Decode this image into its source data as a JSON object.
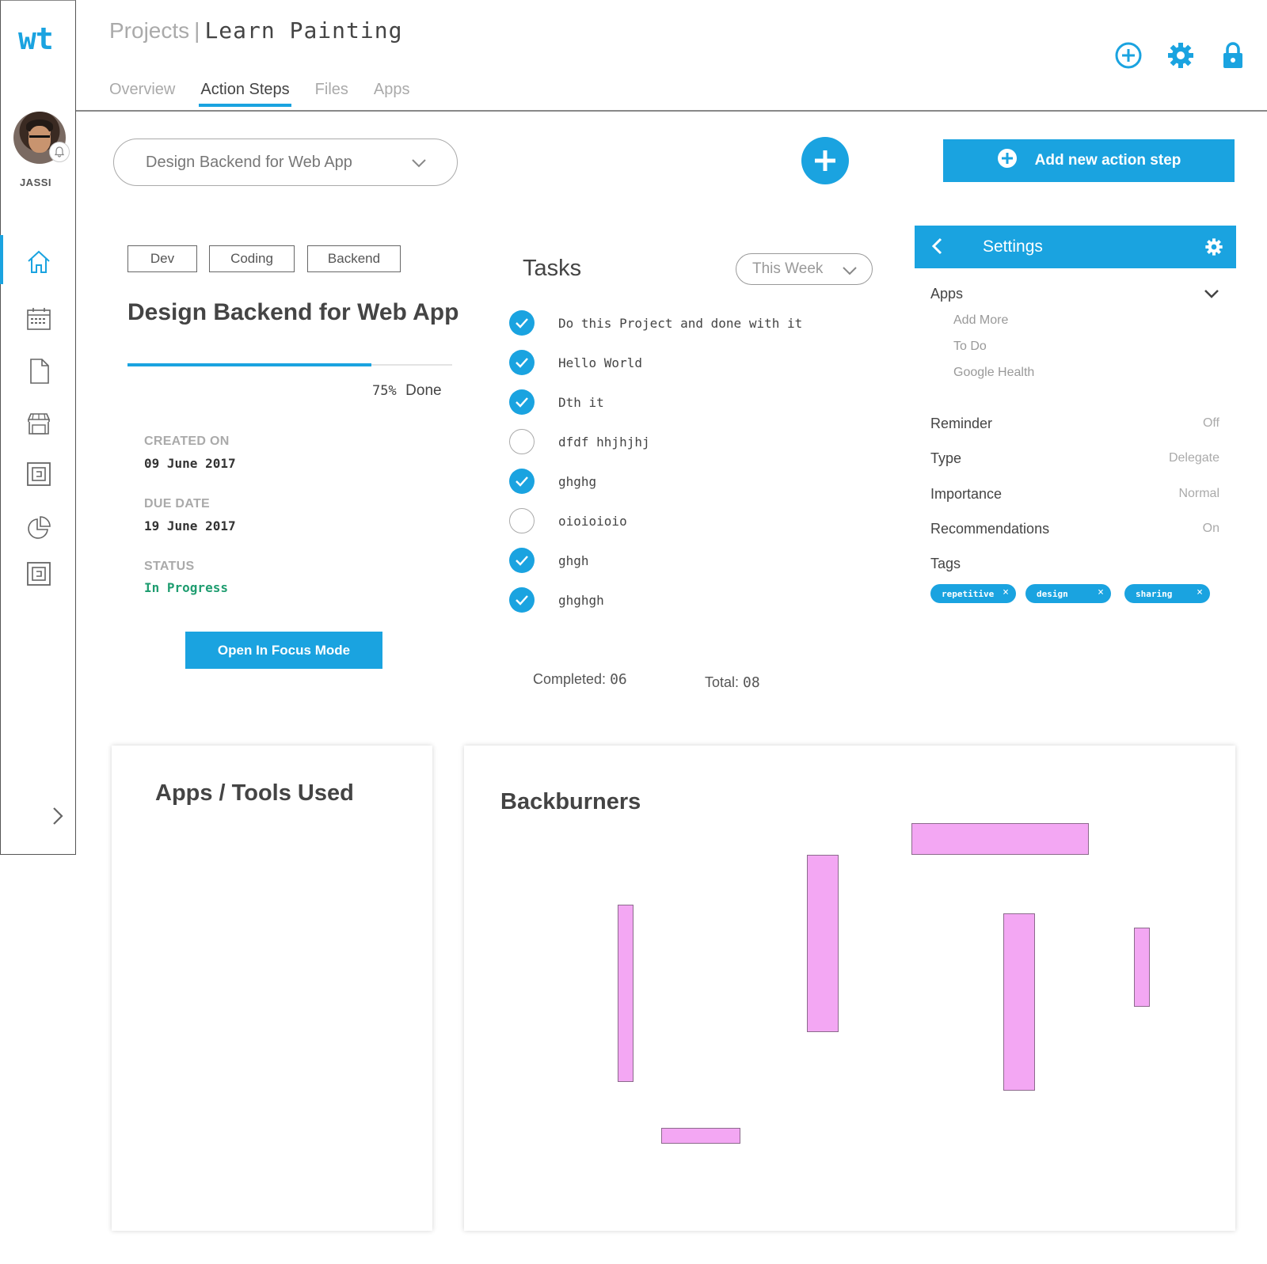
{
  "app": {
    "logo": "wt"
  },
  "user": {
    "name": "JASSI"
  },
  "breadcrumb": {
    "parent": "Projects",
    "separator": "|",
    "current": "Learn Painting"
  },
  "tabs": [
    {
      "label": "Overview",
      "active": false
    },
    {
      "label": "Action Steps",
      "active": true
    },
    {
      "label": "Files",
      "active": false
    },
    {
      "label": "Apps",
      "active": false
    }
  ],
  "action_select": {
    "value": "Design Backend for Web App"
  },
  "add_step": {
    "label": "Add new action step"
  },
  "detail": {
    "tags": [
      "Dev",
      "Coding",
      "Backend"
    ],
    "title": "Design Backend for Web App",
    "progress": 0.75,
    "progress_pct": "75%",
    "progress_suffix": "Done",
    "created_label": "CREATED ON",
    "created_value": "09 June 2017",
    "due_label": "DUE DATE",
    "due_value": "19 June 2017",
    "status_label": "STATUS",
    "status_value": "In Progress",
    "focus_button": "Open In Focus Mode"
  },
  "tasks": {
    "title": "Tasks",
    "filter": "This Week",
    "items": [
      {
        "text": "Do this Project and done with it",
        "done": true
      },
      {
        "text": "Hello World",
        "done": true
      },
      {
        "text": "Dth it",
        "done": true
      },
      {
        "text": "dfdf hhjhjhj",
        "done": false
      },
      {
        "text": "ghghg",
        "done": true
      },
      {
        "text": "oioioioio",
        "done": false
      },
      {
        "text": "ghgh",
        "done": true
      },
      {
        "text": "ghghgh",
        "done": true
      }
    ],
    "completed_label": "Completed:",
    "completed_value": "06",
    "total_label": "Total:",
    "total_value": "08"
  },
  "settings": {
    "title": "Settings",
    "apps_label": "Apps",
    "apps": [
      "Add More",
      "To Do",
      "Google Health"
    ],
    "rows": [
      {
        "label": "Reminder",
        "value": "Off"
      },
      {
        "label": "Type",
        "value": "Delegate"
      },
      {
        "label": "Importance",
        "value": "Normal"
      },
      {
        "label": "Recommendations",
        "value": "On"
      }
    ],
    "tags_label": "Tags",
    "tags": [
      "repetitive",
      "design",
      "sharing"
    ],
    "tag_remove": "×"
  },
  "apps_tools": {
    "title": "Apps / Tools Used"
  },
  "backburners": {
    "title": "Backburners"
  },
  "colors": {
    "accent": "#1aa3e0",
    "status": "#1f9d70",
    "backburner": "#f3a7f3"
  }
}
